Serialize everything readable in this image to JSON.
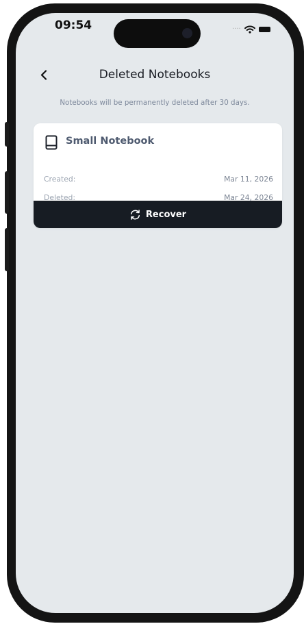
{
  "status_bar": {
    "time": "09:54",
    "icons": [
      "signal-dots-icon",
      "wifi-icon",
      "battery-icon"
    ]
  },
  "header": {
    "back_icon": "chevron-left-icon",
    "title": "Deleted Notebooks",
    "subtitle": "Notebooks will be permanently deleted after 30 days."
  },
  "notebooks": [
    {
      "icon": "notebook-icon",
      "name": "Small Notebook",
      "created_label": "Created:",
      "created_value": "Mar 11, 2026",
      "deleted_label": "Deleted:",
      "deleted_value": "Mar 24, 2026",
      "recover_icon": "refresh-icon",
      "recover_label": "Recover"
    }
  ],
  "colors": {
    "screen_background": "#e5e9ec",
    "card_background": "#ffffff",
    "button_background": "#171c23",
    "button_text": "#ffffff",
    "title_text": "#1a1d24",
    "subtitle_text": "#7d889b",
    "notebook_title": "#4f5b70",
    "label_text": "#9aa3b0",
    "value_text": "#7c8594"
  }
}
